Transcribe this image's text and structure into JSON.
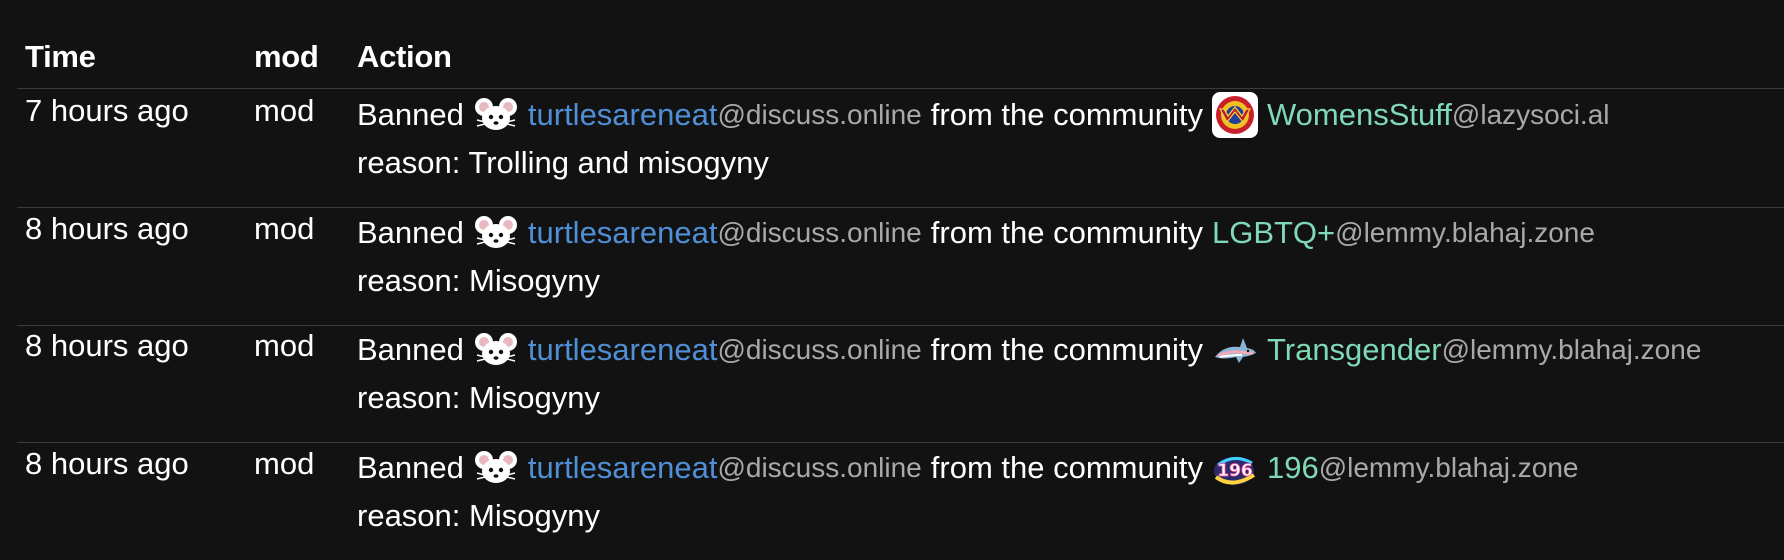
{
  "table": {
    "headers": {
      "time": "Time",
      "mod": "mod",
      "action": "Action"
    },
    "rows": [
      {
        "time": "7 hours ago",
        "mod": "mod",
        "verb": "Banned",
        "user_name": "turtlesareneat",
        "user_instance": "@discuss.online",
        "middle": "from the community",
        "community_icon": "wonder-woman-badge-icon",
        "community_name": "WomensStuff",
        "community_instance": "@lazysoci.al",
        "reason": "reason: Trolling and misogyny"
      },
      {
        "time": "8 hours ago",
        "mod": "mod",
        "verb": "Banned",
        "user_name": "turtlesareneat",
        "user_instance": "@discuss.online",
        "middle": "from the community",
        "community_icon": "",
        "community_name": "LGBTQ+",
        "community_instance": "@lemmy.blahaj.zone",
        "reason": "reason: Misogyny"
      },
      {
        "time": "8 hours ago",
        "mod": "mod",
        "verb": "Banned",
        "user_name": "turtlesareneat",
        "user_instance": "@discuss.online",
        "middle": "from the community",
        "community_icon": "trans-shark-icon",
        "community_name": "Transgender",
        "community_instance": "@lemmy.blahaj.zone",
        "reason": "reason: Misogyny"
      },
      {
        "time": "8 hours ago",
        "mod": "mod",
        "verb": "Banned",
        "user_name": "turtlesareneat",
        "user_instance": "@discuss.online",
        "middle": "from the community",
        "community_icon": "196-badge-icon",
        "community_name": "196",
        "community_instance": "@lemmy.blahaj.zone",
        "reason": "reason: Misogyny"
      }
    ],
    "user_avatar_icon": "mouse-avatar-icon"
  },
  "colors": {
    "background": "#121212",
    "user_link": "#4f8fd6",
    "community_link": "#7fd8b6",
    "instance_text": "#a9a9a9",
    "divider": "#3a3a3a"
  }
}
